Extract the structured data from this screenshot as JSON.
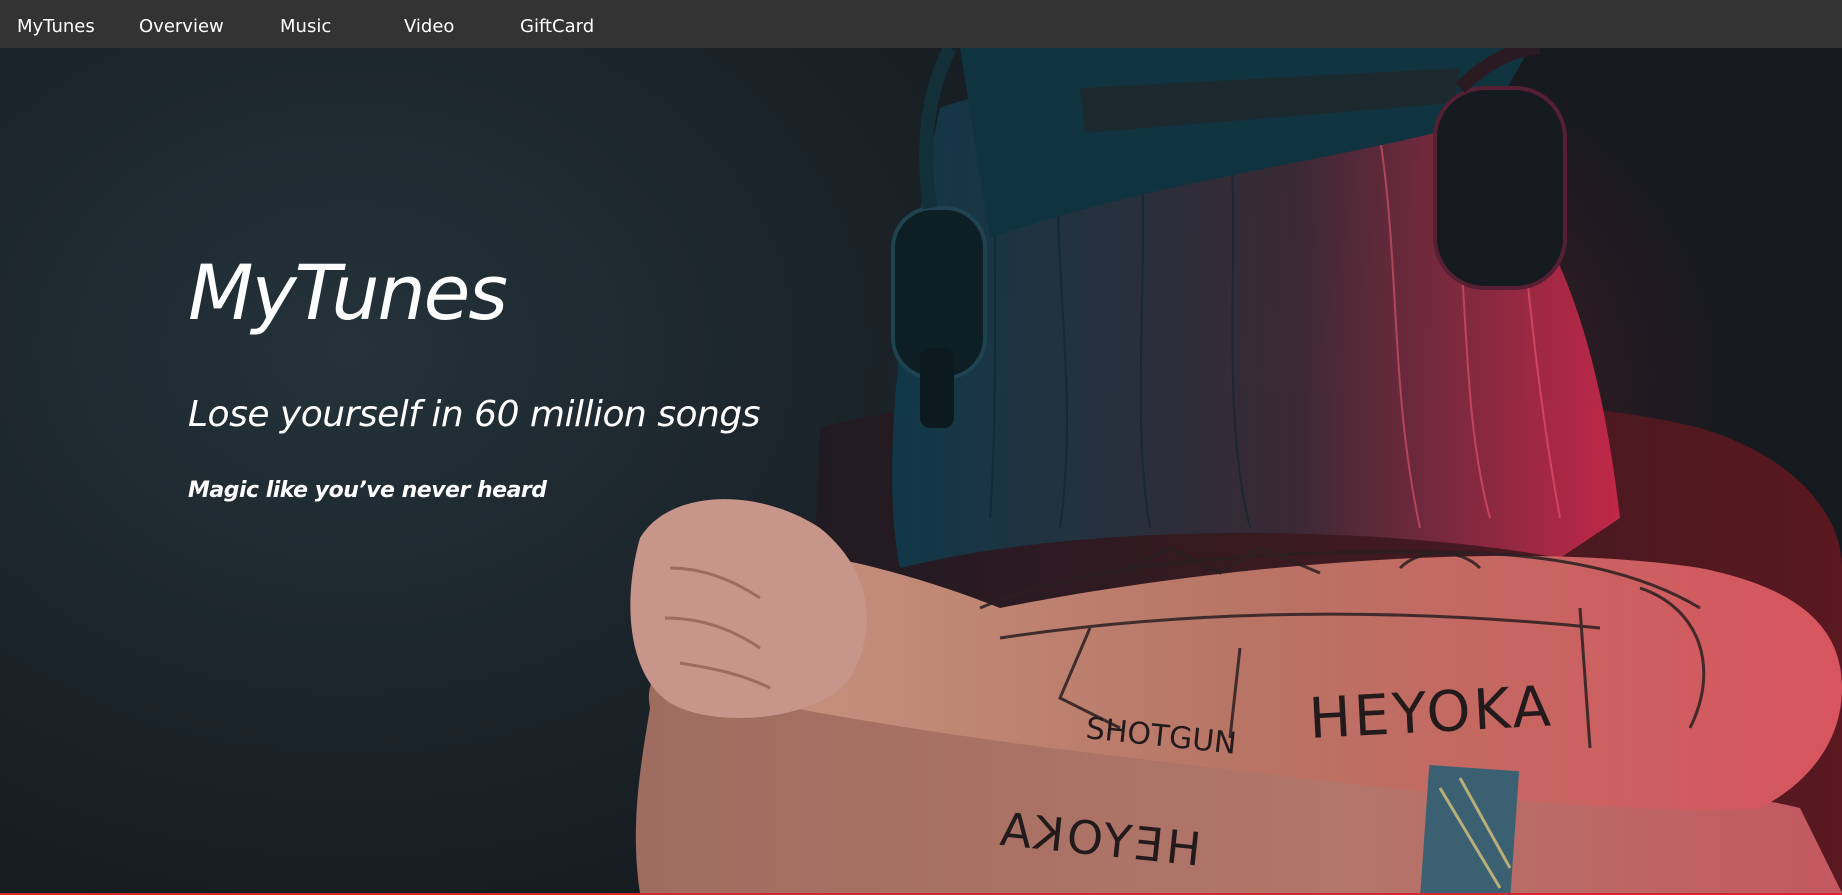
{
  "navbar": {
    "brand": "MyTunes",
    "items": [
      {
        "label": "Overview"
      },
      {
        "label": "Music"
      },
      {
        "label": "Video"
      },
      {
        "label": "GiftCard"
      }
    ],
    "background": "#333333"
  },
  "hero": {
    "title": "MyTunes",
    "subtitle": "Lose yourself in 60 million songs",
    "tagline": "Magic like you’ve never heard",
    "image": {
      "subject": "person-with-headphones-and-tattooed-arms",
      "tattoo_text_upper": "HEYOKA",
      "tattoo_text_small": "SHOTGUN",
      "tattoo_text_lower": "HEYOKA"
    }
  },
  "colors": {
    "accent": "#d7262c",
    "text": "#ffffff",
    "backdrop": "#1c2227"
  }
}
